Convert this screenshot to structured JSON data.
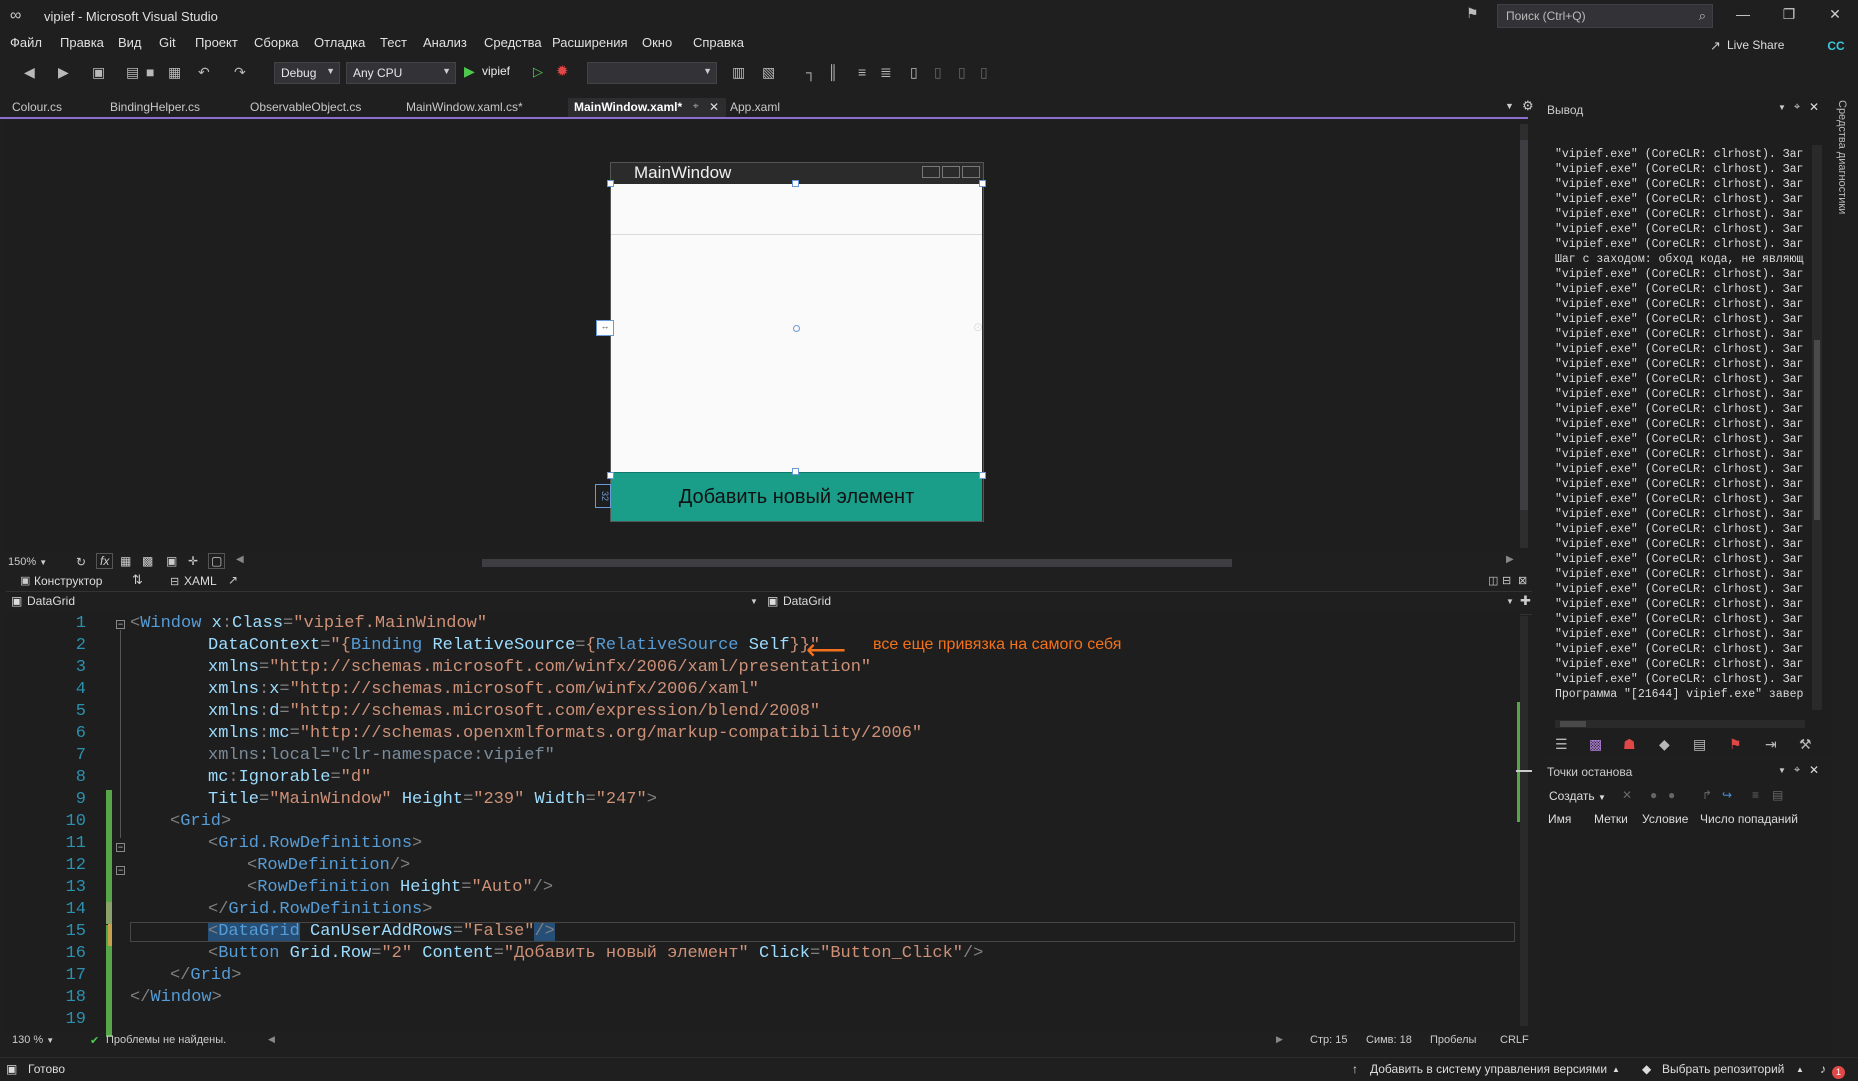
{
  "window": {
    "title": "vipief - Microsoft Visual Studio",
    "search_placeholder": "Поиск (Ctrl+Q)",
    "live_share": "Live Share",
    "avatar": "CC"
  },
  "menu": [
    "Файл",
    "Правка",
    "Вид",
    "Git",
    "Проект",
    "Сборка",
    "Отладка",
    "Тест",
    "Анализ",
    "Средства",
    "Расширения",
    "Окно",
    "Справка"
  ],
  "toolbar": {
    "config": "Debug",
    "platform": "Any CPU",
    "run_target": "vipief"
  },
  "tabs": [
    {
      "label": "Colour.cs"
    },
    {
      "label": "BindingHelper.cs"
    },
    {
      "label": "ObservableObject.cs"
    },
    {
      "label": "MainWindow.xaml.cs*"
    },
    {
      "label": "MainWindow.xaml*",
      "active": true
    },
    {
      "label": "App.xaml"
    }
  ],
  "designer": {
    "window_title": "MainWindow",
    "button_text": "Добавить новый элемент",
    "zoom": "150%",
    "view_designer": "Конструктор",
    "view_xaml": "XAML",
    "grid_marker": "32"
  },
  "navbar": {
    "left": "DataGrid",
    "right": "DataGrid"
  },
  "code": {
    "line_numbers": [
      "1",
      "2",
      "3",
      "4",
      "5",
      "6",
      "7",
      "8",
      "9",
      "10",
      "11",
      "12",
      "13",
      "14",
      "15",
      "16",
      "17",
      "18",
      "19"
    ],
    "annotation": "все еще привязка на самого себя",
    "zoom": "130 %",
    "problems": "Проблемы не найдены.",
    "line": "Стр: 15",
    "col": "Симв: 18",
    "spaces": "Пробелы",
    "eol": "CRLF"
  },
  "output": {
    "title": "Вывод",
    "lines": [
      "\"vipief.exe\" (CoreCLR: clrhost). Заг",
      "\"vipief.exe\" (CoreCLR: clrhost). Заг",
      "\"vipief.exe\" (CoreCLR: clrhost). Заг",
      "\"vipief.exe\" (CoreCLR: clrhost). Заг",
      "\"vipief.exe\" (CoreCLR: clrhost). Заг",
      "\"vipief.exe\" (CoreCLR: clrhost). Заг",
      "\"vipief.exe\" (CoreCLR: clrhost). Заг",
      "Шаг с заходом: обход кода, не являющ",
      "\"vipief.exe\" (CoreCLR: clrhost). Заг",
      "\"vipief.exe\" (CoreCLR: clrhost). Заг",
      "\"vipief.exe\" (CoreCLR: clrhost). Заг",
      "\"vipief.exe\" (CoreCLR: clrhost). Заг",
      "\"vipief.exe\" (CoreCLR: clrhost). Заг",
      "\"vipief.exe\" (CoreCLR: clrhost). Заг",
      "\"vipief.exe\" (CoreCLR: clrhost). Заг",
      "\"vipief.exe\" (CoreCLR: clrhost). Заг",
      "\"vipief.exe\" (CoreCLR: clrhost). Заг",
      "\"vipief.exe\" (CoreCLR: clrhost). Заг",
      "\"vipief.exe\" (CoreCLR: clrhost). Заг",
      "\"vipief.exe\" (CoreCLR: clrhost). Заг",
      "\"vipief.exe\" (CoreCLR: clrhost). Заг",
      "\"vipief.exe\" (CoreCLR: clrhost). Заг",
      "\"vipief.exe\" (CoreCLR: clrhost). Заг",
      "\"vipief.exe\" (CoreCLR: clrhost). Заг",
      "\"vipief.exe\" (CoreCLR: clrhost). Заг",
      "\"vipief.exe\" (CoreCLR: clrhost). Заг",
      "\"vipief.exe\" (CoreCLR: clrhost). Заг",
      "\"vipief.exe\" (CoreCLR: clrhost). Заг",
      "\"vipief.exe\" (CoreCLR: clrhost). Заг",
      "\"vipief.exe\" (CoreCLR: clrhost). Заг",
      "\"vipief.exe\" (CoreCLR: clrhost). Заг",
      "\"vipief.exe\" (CoreCLR: clrhost). Заг",
      "\"vipief.exe\" (CoreCLR: clrhost). Заг",
      "\"vipief.exe\" (CoreCLR: clrhost). Заг",
      "\"vipief.exe\" (CoreCLR: clrhost). Заг",
      "\"vipief.exe\" (CoreCLR: clrhost). Заг",
      "Программа \"[21644] vipief.exe\" завер"
    ]
  },
  "breakpoints": {
    "title": "Точки останова",
    "create": "Создать",
    "columns": [
      "Имя",
      "Метки",
      "Условие",
      "Число попаданий"
    ]
  },
  "side_strip": "Средства диагностики",
  "status": {
    "ready": "Готово",
    "add_vcs": "Добавить в систему управления версиями",
    "repo": "Выбрать репозиторий",
    "notifications": "1"
  },
  "colors": {
    "accent": "#8a6fd1",
    "button_bg": "#1a9e8a",
    "annotation": "#f3711c"
  }
}
